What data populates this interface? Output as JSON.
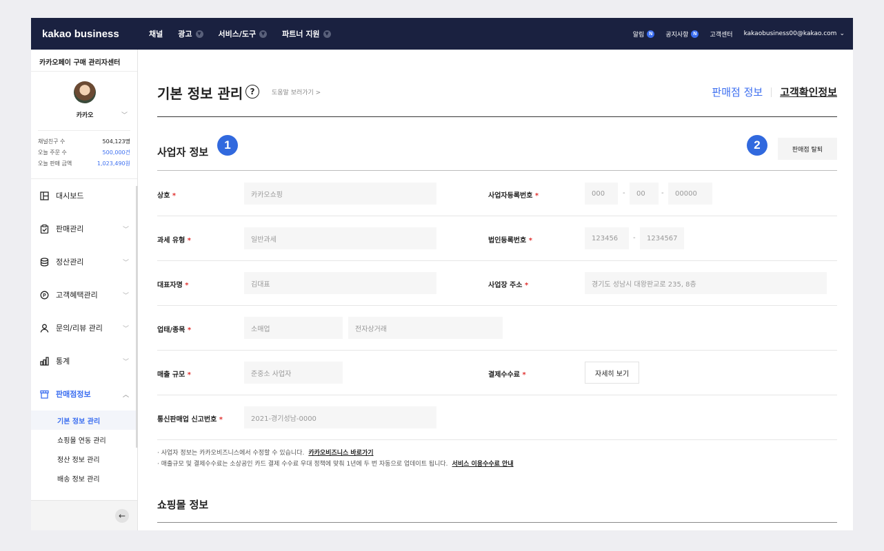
{
  "topbar": {
    "logo": "kakao business",
    "nav": [
      {
        "label": "채널",
        "dropdown": false
      },
      {
        "label": "광고",
        "dropdown": true
      },
      {
        "label": "서비스/도구",
        "dropdown": true
      },
      {
        "label": "파트너 지원",
        "dropdown": true
      }
    ],
    "util": {
      "alerts": "알림",
      "notices": "공지사항",
      "new_badge": "N",
      "support": "고객센터",
      "account": "kakaobusiness00@kakao.com"
    }
  },
  "sidebar": {
    "center_title": "카카오페이 구매 관리자센터",
    "profile_name": "카카오",
    "stats": [
      {
        "label": "채널친구 수",
        "value": "504,123명",
        "highlight": false
      },
      {
        "label": "오늘 주문 수",
        "value": "500,000건",
        "highlight": true
      },
      {
        "label": "오늘 판매 금액",
        "value": "1,023,490원",
        "highlight": true
      }
    ],
    "menu": [
      {
        "label": "대시보드",
        "icon": "dashboard-icon"
      },
      {
        "label": "판매관리",
        "icon": "clipboard-icon"
      },
      {
        "label": "정산관리",
        "icon": "database-icon"
      },
      {
        "label": "고객혜택관리",
        "icon": "point-icon"
      },
      {
        "label": "문의/리뷰 관리",
        "icon": "person-icon"
      },
      {
        "label": "통계",
        "icon": "bar-chart-icon"
      },
      {
        "label": "판매점정보",
        "icon": "store-icon"
      }
    ],
    "submenu": [
      "기본 정보 관리",
      "쇼핑몰 연동 관리",
      "정산 정보 관리",
      "배송 정보 관리"
    ]
  },
  "main": {
    "page_title": "기본 정보 관리",
    "help_link": "도움말 보러가기 >",
    "tab_store": "판매점 정보",
    "tab_customer": "고객확인정보",
    "section_business": "사업자 정보",
    "quit_button": "판매점 탈퇴",
    "markers": [
      "1",
      "2"
    ],
    "fields": {
      "company_label": "상호",
      "company_value": "카카오쇼핑",
      "brn_label": "사업자등록번호",
      "brn_1": "000",
      "brn_2": "00",
      "brn_3": "00000",
      "tax_label": "과세 유형",
      "tax_value": "일반과세",
      "corp_label": "법인등록번호",
      "corp_1": "123456",
      "corp_2": "1234567",
      "ceo_label": "대표자명",
      "ceo_value": "김대표",
      "addr_label": "사업장 주소",
      "addr_value": "경기도 성남시 대왕판교로 235, 8층",
      "biz_label": "업태/종목",
      "biz_type": "소매업",
      "biz_item": "전자상거래",
      "sales_label": "매출 규모",
      "sales_value": "준중소 사업자",
      "fee_label": "결제수수료",
      "fee_button": "자세히 보기",
      "mail_label": "통신판매업 신고번호",
      "mail_value": "2021-경기성남-0000"
    },
    "required_mark": "*",
    "dash": "-",
    "note1": "· 사업자 정보는 카카오비즈니스에서 수정할 수 있습니다.",
    "note1_link": "카카오비즈니스 바로가기",
    "note2": "· 매출규모 및 결제수수료는 소상공인 카드 결제 수수료 우대 정책에 맞춰 1년에 두 번 자동으로 업데이트 됩니다.",
    "note2_link": "서비스 이용수수료 안내",
    "section_mall": "쇼핑몰 정보"
  }
}
